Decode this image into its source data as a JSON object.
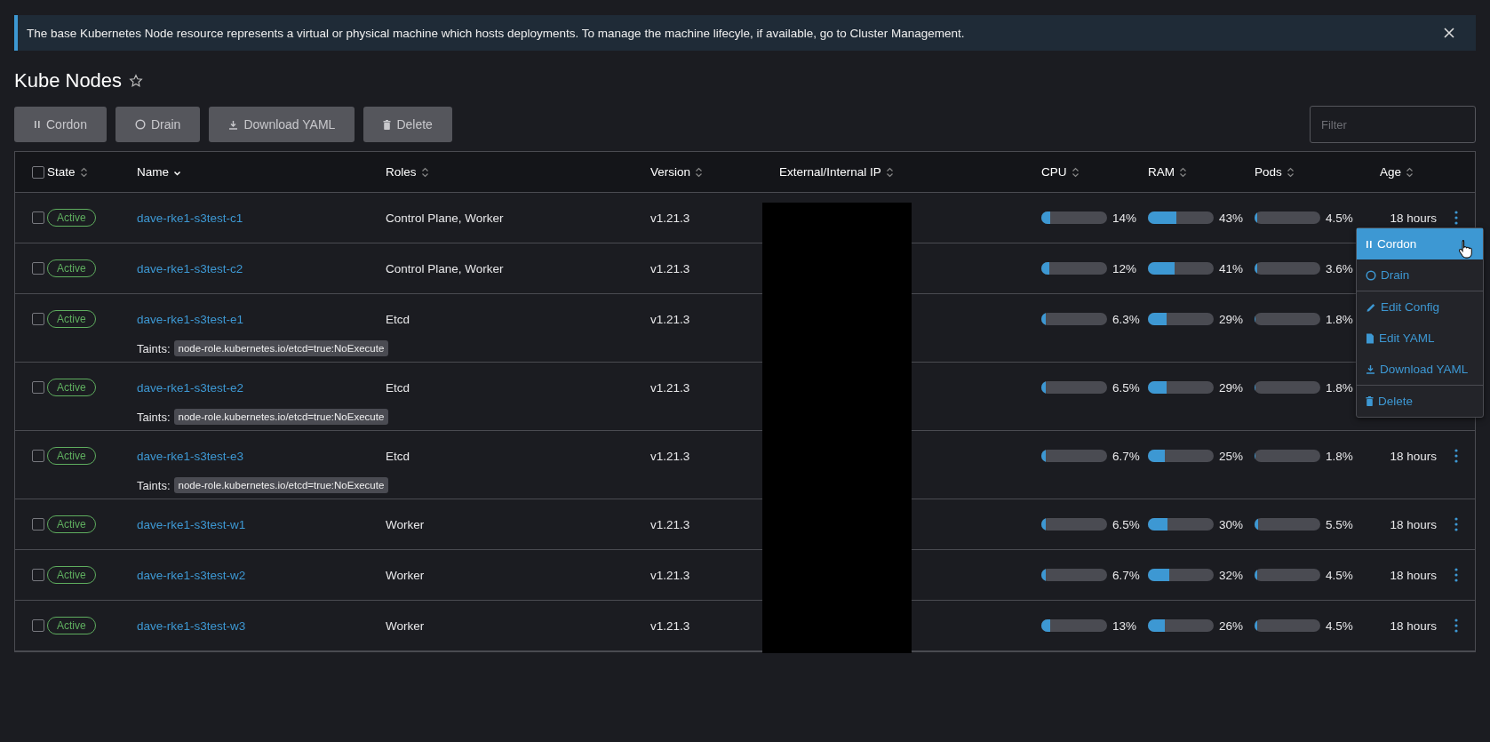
{
  "banner": {
    "text": "The base Kubernetes Node resource represents a virtual or physical machine which hosts deployments. To manage the machine lifecyle, if available, go to Cluster Management."
  },
  "page": {
    "title": "Kube Nodes",
    "favorite": false
  },
  "toolbar": [
    {
      "label": "Cordon",
      "disabled": true
    },
    {
      "label": "Drain",
      "disabled": true
    },
    {
      "label": "Download YAML",
      "disabled": true
    },
    {
      "label": "Delete",
      "disabled": true
    }
  ],
  "filter": {
    "placeholder": "Filter"
  },
  "table": {
    "select_all": {
      "checked": false
    },
    "columns": [
      {
        "label": "State",
        "sorted": false
      },
      {
        "label": "Name",
        "sorted": true
      },
      {
        "label": "Roles",
        "sorted": false
      },
      {
        "label": "Version",
        "sorted": false
      },
      {
        "label": "External/Internal IP",
        "sorted": false
      },
      {
        "label": "CPU",
        "sorted": false
      },
      {
        "label": "RAM",
        "sorted": false
      },
      {
        "label": "Pods",
        "sorted": false
      },
      {
        "label": "Age",
        "sorted": false
      }
    ],
    "rows": [
      {
        "checked": false,
        "state": "Active",
        "name": "dave-rke1-s3test-c1",
        "roles": "Control Plane, Worker",
        "version": "v1.21.3",
        "cpu": {
          "level": 0.14,
          "reading": "14%"
        },
        "ram": {
          "level": 0.43,
          "reading": "43%"
        },
        "pods": {
          "level": 0.045,
          "reading": "4.5%"
        },
        "age": "18 hours"
      },
      {
        "checked": false,
        "state": "Active",
        "name": "dave-rke1-s3test-c2",
        "roles": "Control Plane, Worker",
        "version": "v1.21.3",
        "cpu": {
          "level": 0.12,
          "reading": "12%"
        },
        "ram": {
          "level": 0.41,
          "reading": "41%"
        },
        "pods": {
          "level": 0.036,
          "reading": "3.6%"
        }
      },
      {
        "checked": false,
        "state": "Active",
        "name": "dave-rke1-s3test-e1",
        "roles": "Etcd",
        "version": "v1.21.3",
        "cpu": {
          "level": 0.063,
          "reading": "6.3%"
        },
        "ram": {
          "level": 0.29,
          "reading": "29%"
        },
        "pods": {
          "level": 0.018,
          "reading": "1.8%"
        },
        "taints_label": "Taints:",
        "taints": [
          "node-role.kubernetes.io/etcd=true:NoExecute"
        ]
      },
      {
        "checked": false,
        "state": "Active",
        "name": "dave-rke1-s3test-e2",
        "roles": "Etcd",
        "version": "v1.21.3",
        "cpu": {
          "level": 0.065,
          "reading": "6.5%"
        },
        "ram": {
          "level": 0.29,
          "reading": "29%"
        },
        "pods": {
          "level": 0.018,
          "reading": "1.8%"
        },
        "taints_label": "Taints:",
        "taints": [
          "node-role.kubernetes.io/etcd=true:NoExecute"
        ]
      },
      {
        "checked": false,
        "state": "Active",
        "name": "dave-rke1-s3test-e3",
        "roles": "Etcd",
        "version": "v1.21.3",
        "cpu": {
          "level": 0.067,
          "reading": "6.7%"
        },
        "ram": {
          "level": 0.25,
          "reading": "25%"
        },
        "pods": {
          "level": 0.018,
          "reading": "1.8%"
        },
        "age": "18 hours",
        "taints_label": "Taints:",
        "taints": [
          "node-role.kubernetes.io/etcd=true:NoExecute"
        ]
      },
      {
        "checked": false,
        "state": "Active",
        "name": "dave-rke1-s3test-w1",
        "roles": "Worker",
        "version": "v1.21.3",
        "cpu": {
          "level": 0.065,
          "reading": "6.5%"
        },
        "ram": {
          "level": 0.3,
          "reading": "30%"
        },
        "pods": {
          "level": 0.055,
          "reading": "5.5%"
        },
        "age": "18 hours"
      },
      {
        "checked": false,
        "state": "Active",
        "name": "dave-rke1-s3test-w2",
        "roles": "Worker",
        "version": "v1.21.3",
        "cpu": {
          "level": 0.067,
          "reading": "6.7%"
        },
        "ram": {
          "level": 0.32,
          "reading": "32%"
        },
        "pods": {
          "level": 0.045,
          "reading": "4.5%"
        },
        "age": "18 hours"
      },
      {
        "checked": false,
        "state": "Active",
        "name": "dave-rke1-s3test-w3",
        "roles": "Worker",
        "version": "v1.21.3",
        "cpu": {
          "level": 0.13,
          "reading": "13%"
        },
        "ram": {
          "level": 0.26,
          "reading": "26%"
        },
        "pods": {
          "level": 0.045,
          "reading": "4.5%"
        },
        "age": "18 hours"
      }
    ]
  },
  "action_menu": {
    "groups": [
      [
        {
          "label": "Cordon",
          "selected": true
        },
        {
          "label": "Drain",
          "selected": false
        }
      ],
      [
        {
          "label": "Edit Config",
          "selected": false
        },
        {
          "label": "Edit YAML",
          "selected": false
        },
        {
          "label": "Download YAML",
          "selected": false
        }
      ],
      [
        {
          "label": "Delete",
          "selected": false
        }
      ]
    ]
  }
}
